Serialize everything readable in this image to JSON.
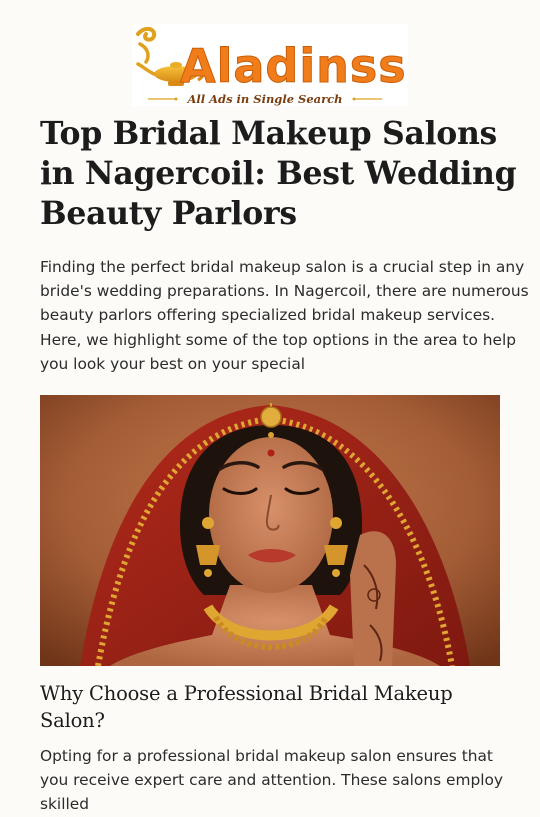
{
  "brand": {
    "name": "Aladinss",
    "tagline": "All Ads in Single Search"
  },
  "article": {
    "title": "Top Bridal Makeup Salons in Nagercoil: Best Wedding Beauty Parlors",
    "intro": "Finding the perfect bridal makeup salon is a crucial step in any bride's wedding preparations. In Nagercoil, there are numerous beauty parlors offering specialized bridal makeup services. Here, we highlight some of the top options in the area to help you look your best on your special",
    "section_heading": "Why Choose a Professional Bridal Makeup Salon?",
    "section_text": "Opting for a professional bridal makeup salon ensures that you receive expert care and attention. These salons employ skilled"
  },
  "colors": {
    "brand_orange": "#f07c1a",
    "brand_dark": "#7a3d10",
    "page_bg": "#fcfbf7",
    "heading": "#1c1c1c"
  },
  "icons": {
    "logo": "genie-lamp-icon"
  }
}
